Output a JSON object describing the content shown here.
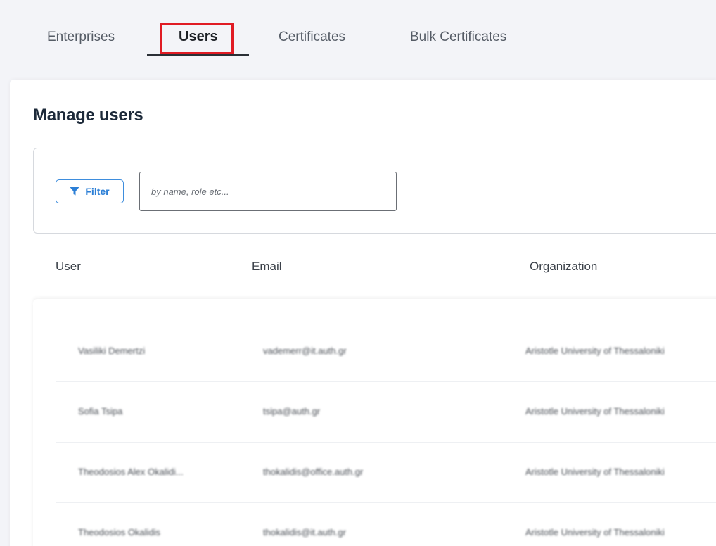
{
  "tabs": [
    {
      "label": "Enterprises",
      "active": false
    },
    {
      "label": "Users",
      "active": true
    },
    {
      "label": "Certificates",
      "active": false
    },
    {
      "label": "Bulk Certificates",
      "active": false
    }
  ],
  "page_title": "Manage users",
  "filter": {
    "button_label": "Filter",
    "search_placeholder": "by name, role etc..."
  },
  "table": {
    "columns": [
      "User",
      "Email",
      "Organization"
    ],
    "rows": [
      {
        "user": "Vasiliki Demertzi",
        "email": "vademerr@it.auth.gr",
        "organization": "Aristotle University of Thessaloniki"
      },
      {
        "user": "Sofia Tsipa",
        "email": "tsipa@auth.gr",
        "organization": "Aristotle University of Thessaloniki"
      },
      {
        "user": "Theodosios Alex Okalidi...",
        "email": "thokalidis@office.auth.gr",
        "organization": "Aristotle University of Thessaloniki"
      },
      {
        "user": "Theodosios Okalidis",
        "email": "thokalidis@it.auth.gr",
        "organization": "Aristotle University of Thessaloniki"
      }
    ]
  },
  "colors": {
    "accent": "#2c7fd6",
    "highlight": "#e01b24",
    "title": "#1d2a3a"
  },
  "icons": {
    "filter": "funnel-icon"
  }
}
